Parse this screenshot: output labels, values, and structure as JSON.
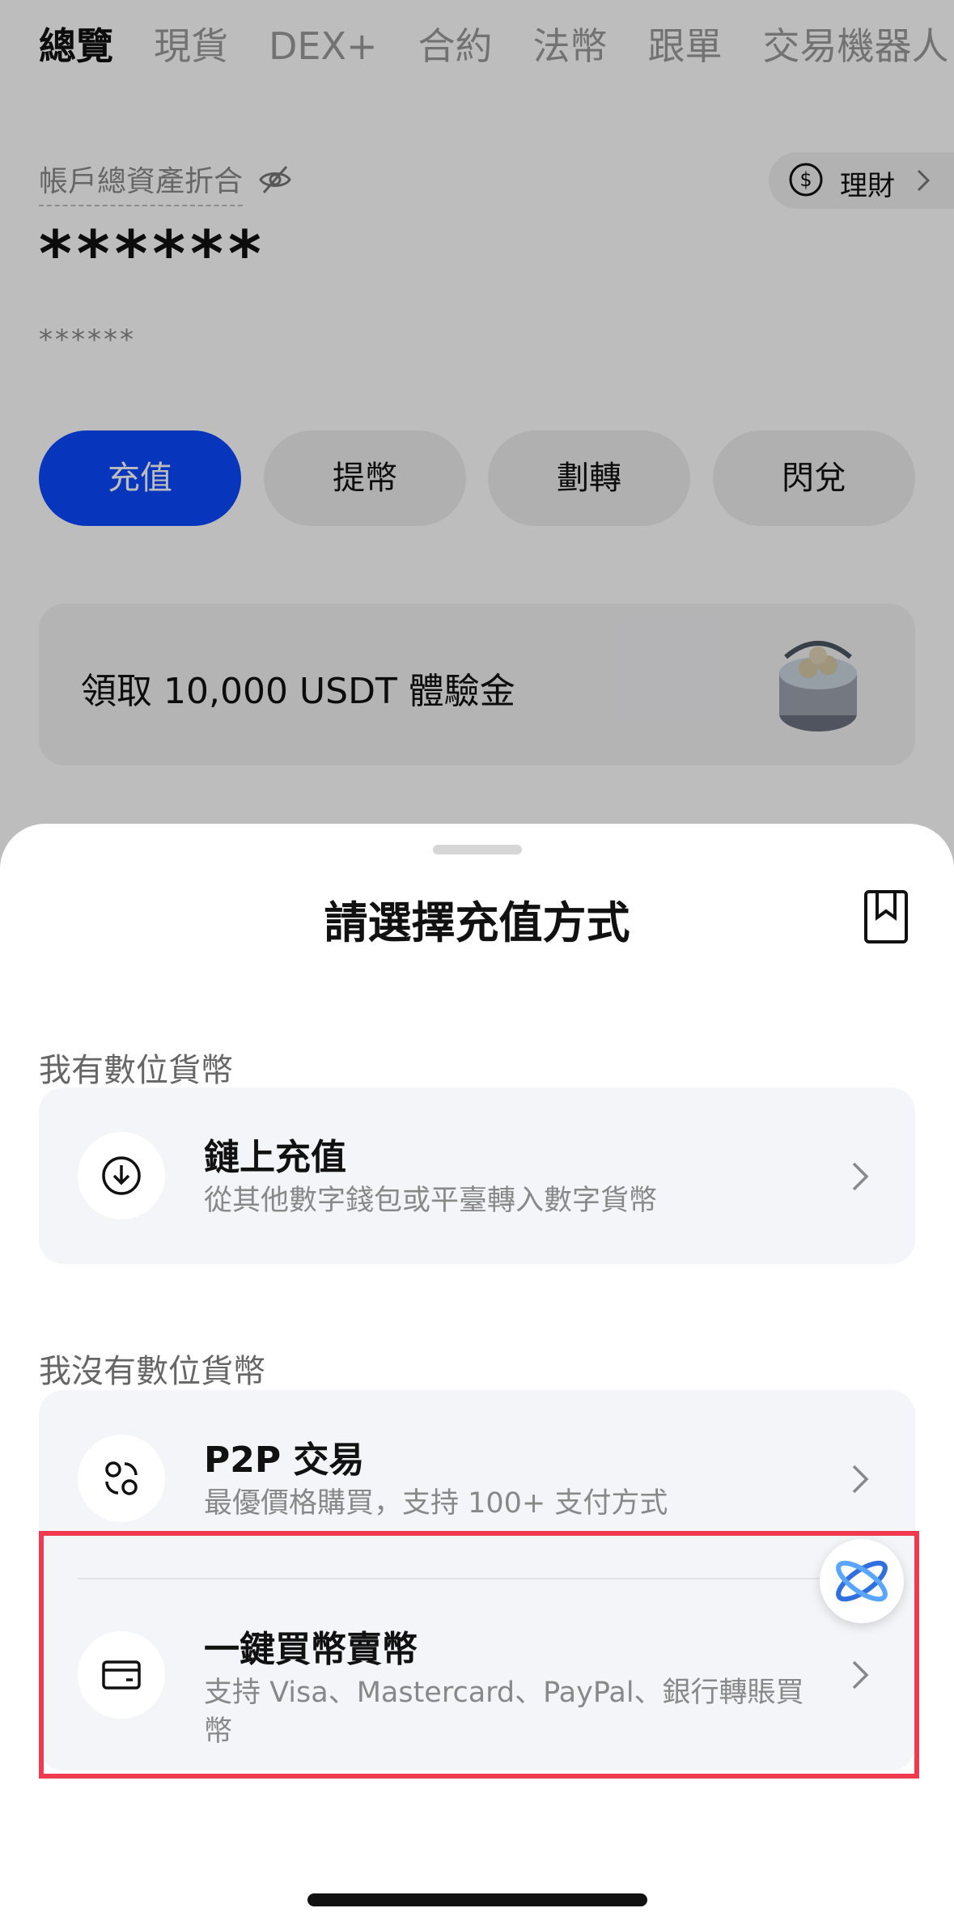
{
  "top_tabs": [
    "總覽",
    "現貨",
    "DEX+",
    "合約",
    "法幣",
    "跟單",
    "交易機器人"
  ],
  "asset": {
    "label": "帳戶總資產折合",
    "balance": "******",
    "sub_balance": "******",
    "finance_label": "理財"
  },
  "actions": [
    "充值",
    "提幣",
    "劃轉",
    "閃兌"
  ],
  "promo": {
    "text": "領取 10,000 USDT 體驗金"
  },
  "sheet": {
    "title": "請選擇充值方式",
    "section_have": "我有數位貨幣",
    "section_none": "我沒有數位貨幣",
    "options": [
      {
        "title": "鏈上充值",
        "desc": "從其他數字錢包或平臺轉入數字貨幣",
        "icon": "download-icon"
      },
      {
        "title": "P2P 交易",
        "desc": "最優價格購買，支持 100+ 支付方式",
        "icon": "p2p-icon"
      },
      {
        "title": "一鍵買幣賣幣",
        "desc": "支持 Visa、Mastercard、PayPal、銀行轉賬買幣",
        "icon": "card-icon"
      }
    ]
  },
  "colors": {
    "primary": "#0a49ff",
    "highlight": "#ee3b4f"
  }
}
